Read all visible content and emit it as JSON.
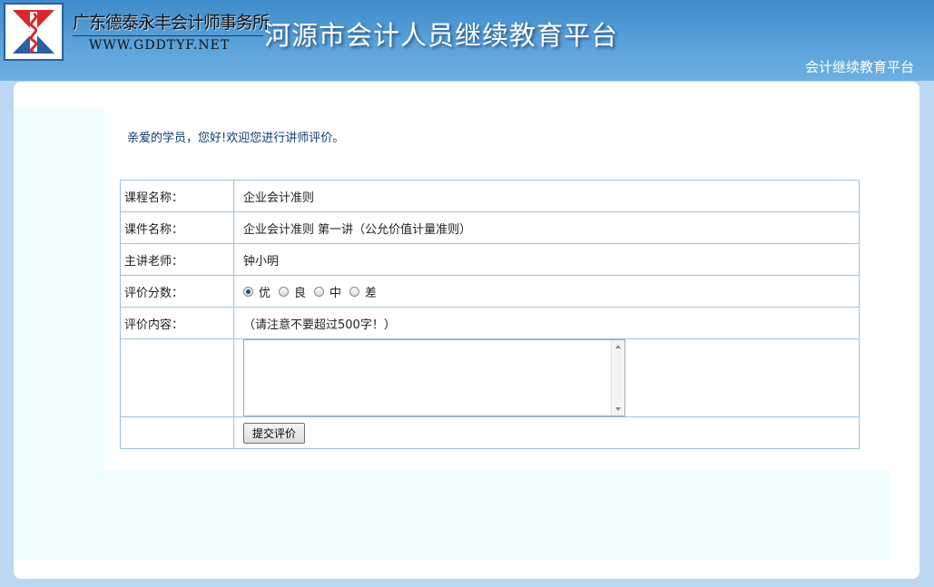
{
  "header": {
    "firm_name": "广东德泰永丰会计师事务所",
    "firm_url": "WWW.GDDTYF.NET",
    "platform_title": "河源市会计人员继续教育平台",
    "sub_title": "会计继续教育平台"
  },
  "main": {
    "greeting": "亲爱的学员，您好!欢迎您进行讲师评价。",
    "rows": {
      "course_label": "课程名称：",
      "course_value": "企业会计准则",
      "lesson_label": "课件名称：",
      "lesson_value": "企业会计准则 第一讲（公允价值计量准则）",
      "teacher_label": "主讲老师：",
      "teacher_value": "钟小明",
      "score_label": "评价分数：",
      "content_label": "评价内容：",
      "content_hint": "（请注意不要超过500字！）"
    },
    "score_options": [
      "优",
      "良",
      "中",
      "差"
    ],
    "score_selected": "优",
    "comment_value": "",
    "submit_label": "提交评价"
  },
  "colors": {
    "header_blue": "#4a96d2",
    "background": "#bcd7f1",
    "border": "#9fc3e0",
    "greeting_text": "#0d3b6e"
  }
}
